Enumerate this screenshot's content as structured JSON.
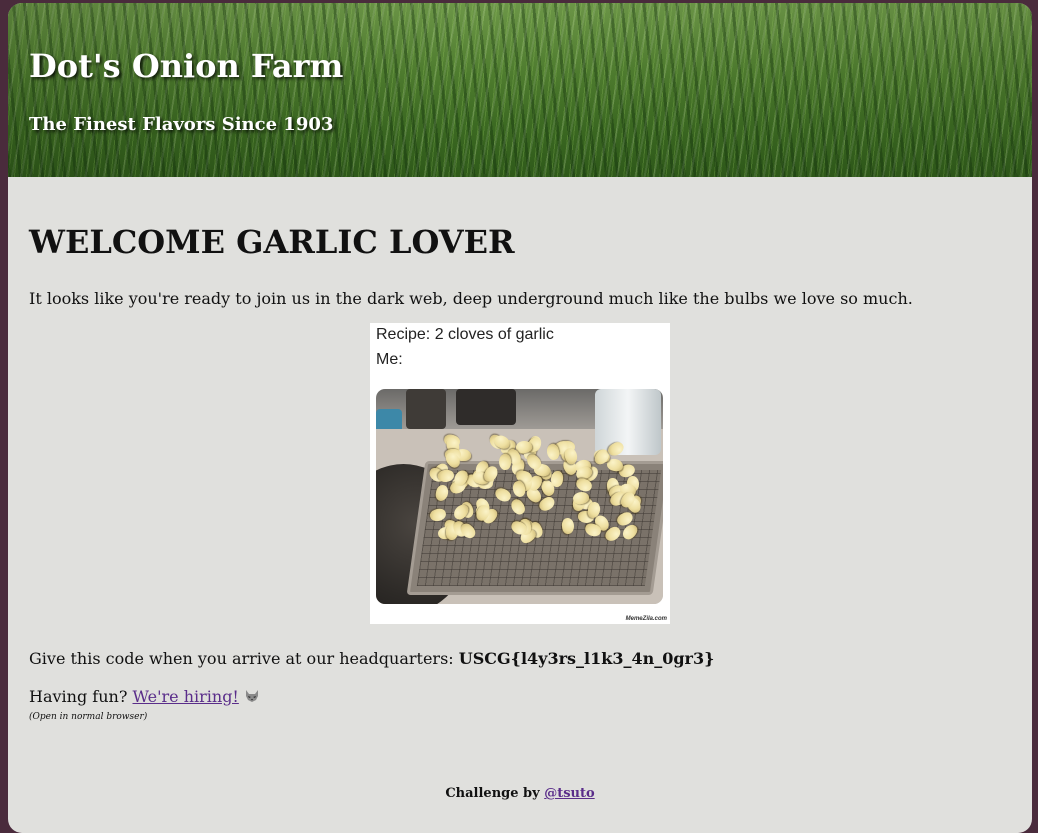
{
  "header": {
    "title": "Dot's Onion Farm",
    "subtitle": "The Finest Flavors Since 1903"
  },
  "main": {
    "heading": "WELCOME GARLIC LOVER",
    "intro": "It looks like you're ready to join us in the dark web, deep underground much like the bulbs we love so much.",
    "meme": {
      "line1": "Recipe: 2 cloves of garlic",
      "line2": "Me:",
      "watermark": "MemeZila.com"
    },
    "code_prefix": "Give this code when you arrive at our headquarters: ",
    "code": "USCG{l4y3rs_l1k3_4n_0gr3}",
    "hiring_prefix": "Having fun? ",
    "hiring_link": "We're hiring!",
    "hiring_icon": "wolf-icon",
    "note": "(Open in normal browser)"
  },
  "footer": {
    "prefix": "Challenge by ",
    "author": "@tsuto"
  },
  "colors": {
    "outer_background": "#4a2b3c",
    "page_background": "#e0e0dd",
    "link": "#5a2d8a"
  }
}
